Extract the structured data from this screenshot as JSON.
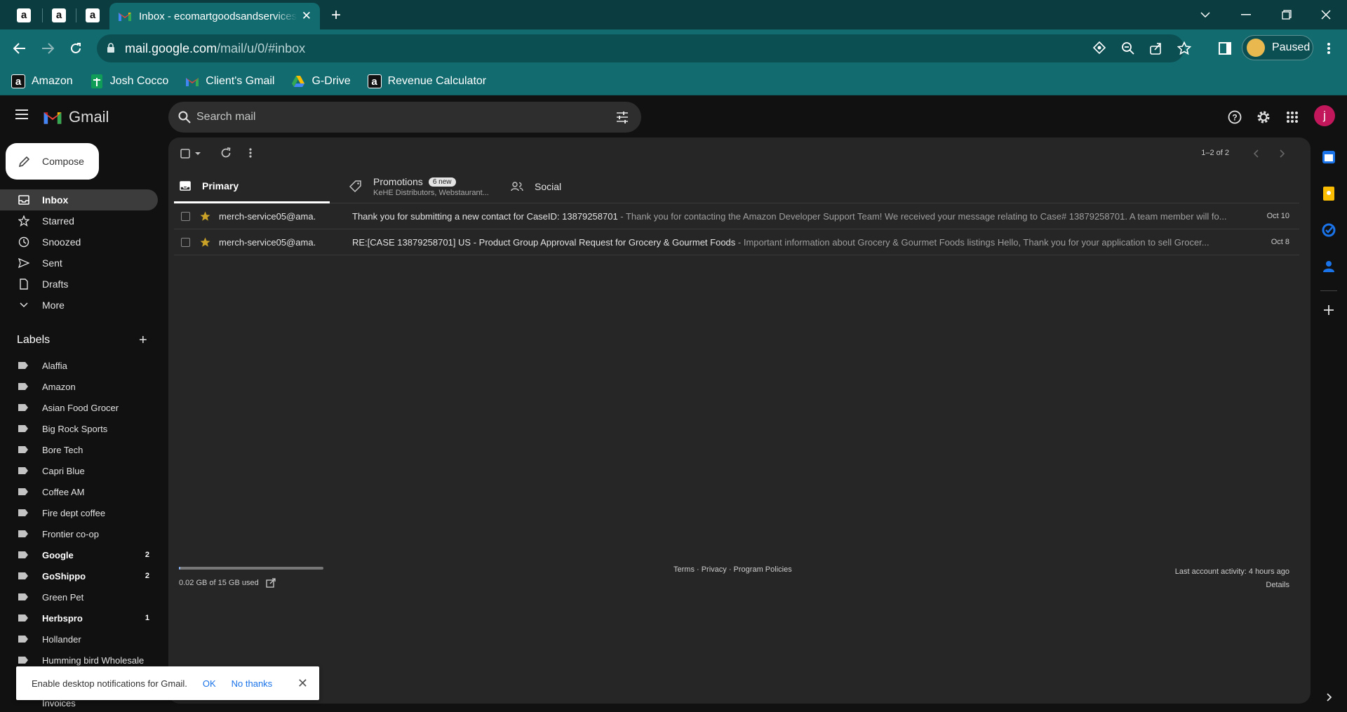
{
  "browser": {
    "active_tab_title": "Inbox - ecomartgoodsandservices",
    "url_host": "mail.google.com",
    "url_path": "/mail/u/0/#inbox",
    "profile_label": "Paused",
    "bookmarks": [
      {
        "label": "Amazon",
        "icon": "amazon-icon"
      },
      {
        "label": "Josh Cocco",
        "icon": "sheets-icon"
      },
      {
        "label": "Client's Gmail",
        "icon": "gmail-icon"
      },
      {
        "label": "G-Drive",
        "icon": "drive-icon"
      },
      {
        "label": "Revenue Calculator",
        "icon": "amazon-icon"
      }
    ]
  },
  "gmail": {
    "app_name": "Gmail",
    "search_placeholder": "Search mail",
    "user_initial": "j",
    "compose_label": "Compose",
    "nav": [
      {
        "label": "Inbox",
        "icon": "inbox-icon",
        "active": true
      },
      {
        "label": "Starred",
        "icon": "star-icon"
      },
      {
        "label": "Snoozed",
        "icon": "clock-icon"
      },
      {
        "label": "Sent",
        "icon": "send-icon"
      },
      {
        "label": "Drafts",
        "icon": "draft-icon"
      },
      {
        "label": "More",
        "icon": "chevron-down-icon"
      }
    ],
    "labels_heading": "Labels",
    "labels": [
      {
        "label": "Alaffia",
        "count": ""
      },
      {
        "label": "Amazon",
        "count": ""
      },
      {
        "label": "Asian Food Grocer",
        "count": ""
      },
      {
        "label": "Big Rock Sports",
        "count": ""
      },
      {
        "label": "Bore Tech",
        "count": ""
      },
      {
        "label": "Capri Blue",
        "count": ""
      },
      {
        "label": "Coffee AM",
        "count": ""
      },
      {
        "label": "Fire dept coffee",
        "count": ""
      },
      {
        "label": "Frontier co-op",
        "count": ""
      },
      {
        "label": "Google",
        "count": "2",
        "bold": true
      },
      {
        "label": "GoShippo",
        "count": "2",
        "bold": true
      },
      {
        "label": "Green Pet",
        "count": ""
      },
      {
        "label": "Herbspro",
        "count": "1",
        "bold": true
      },
      {
        "label": "Hollander",
        "count": ""
      },
      {
        "label": "Humming bird Wholesale",
        "count": ""
      }
    ],
    "partial_label": "Invoices",
    "pager": "1–2 of 2",
    "tabs": {
      "primary": "Primary",
      "promotions": "Promotions",
      "promotions_badge": "6 new",
      "promotions_senders": "KeHE Distributors, Webstaurant...",
      "social": "Social"
    },
    "emails": [
      {
        "from": "merch-service05@ama.",
        "subject": "Thank you for submitting a new contact for CaseID: 13879258701",
        "snippet": " - Thank you for contacting the Amazon Developer Support Team! We received your message relating to Case# 13879258701. A team member will fo...",
        "date": "Oct 10"
      },
      {
        "from": "merch-service05@ama.",
        "subject": "RE:[CASE 13879258701] US - Product Group Approval Request for Grocery & Gourmet Foods",
        "snippet": " - Important information about Grocery & Gourmet Foods listings Hello, Thank you for your application to sell Grocer...",
        "date": "Oct 8"
      }
    ],
    "storage": "0.02 GB of 15 GB used",
    "storage_used_fraction": 0.0013,
    "footer_links": "Terms · Privacy · Program Policies",
    "last_activity": "Last account activity: 4 hours ago",
    "details": "Details",
    "toast": {
      "text": "Enable desktop notifications for Gmail.",
      "ok": "OK",
      "no": "No thanks"
    }
  },
  "colors": {
    "tab_strip": "#0b3d40",
    "toolbar": "#126b6f",
    "gmail_bg": "#111111",
    "panel_bg": "#262626",
    "star": "#c9a227",
    "link": "#1a73e8"
  }
}
